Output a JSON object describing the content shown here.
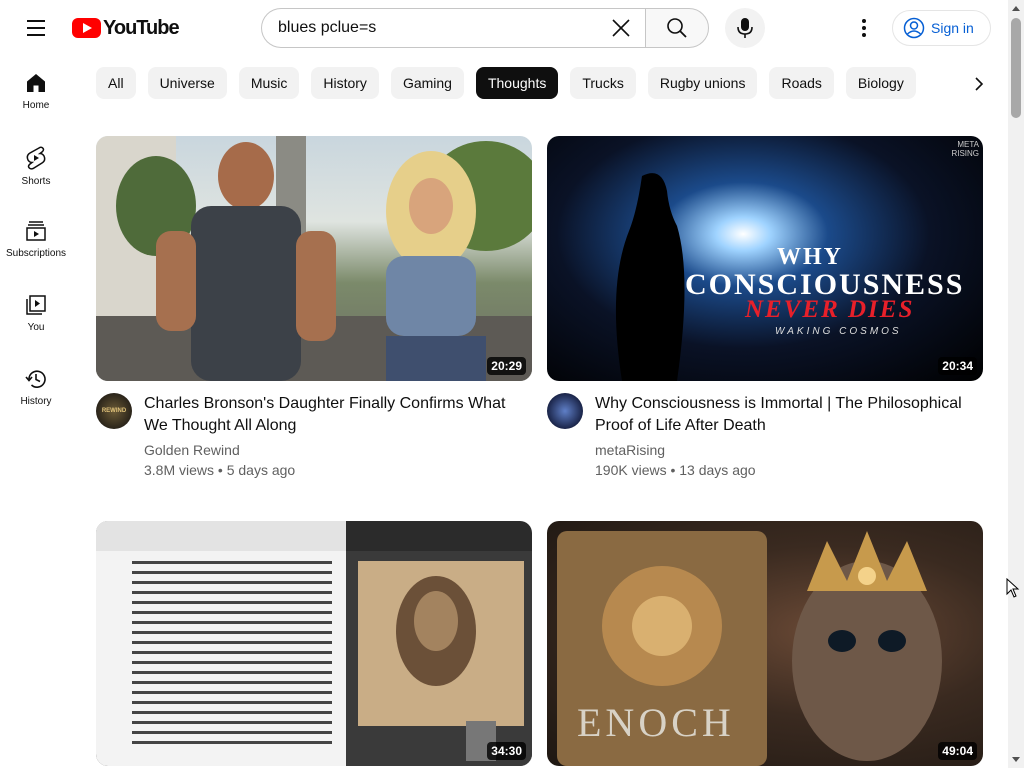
{
  "header": {
    "logo_text": "YouTube",
    "search": {
      "value": "blues pclue=s"
    },
    "signin_label": "Sign in"
  },
  "sidebar": {
    "items": [
      {
        "label": "Home",
        "icon": "home-icon"
      },
      {
        "label": "Shorts",
        "icon": "shorts-icon"
      },
      {
        "label": "Subscriptions",
        "icon": "subscriptions-icon"
      },
      {
        "label": "You",
        "icon": "you-icon"
      },
      {
        "label": "History",
        "icon": "history-icon"
      }
    ]
  },
  "chips": [
    {
      "label": "All",
      "active": false
    },
    {
      "label": "Universe",
      "active": false
    },
    {
      "label": "Music",
      "active": false
    },
    {
      "label": "History",
      "active": false
    },
    {
      "label": "Gaming",
      "active": false
    },
    {
      "label": "Thoughts",
      "active": true
    },
    {
      "label": "Trucks",
      "active": false
    },
    {
      "label": "Rugby unions",
      "active": false
    },
    {
      "label": "Roads",
      "active": false
    },
    {
      "label": "Biology",
      "active": false
    }
  ],
  "videos": [
    {
      "title": "Charles Bronson's Daughter Finally Confirms What We Thought All Along",
      "channel": "Golden Rewind",
      "stats": "3.8M views • 5 days ago",
      "duration": "20:29",
      "avatar_text": "REWIND"
    },
    {
      "title": "Why Consciousness is Immortal | The Philosophical Proof of Life After Death",
      "channel": "metaRising",
      "stats": "190K views • 13 days ago",
      "duration": "20:34",
      "thumb_text": {
        "line1": "WHY",
        "line2": "CONSCIOUSNESS",
        "line3": "NEVER DIES",
        "line4": "WAKING COSMOS",
        "corner": "META RISING"
      }
    },
    {
      "title": "",
      "channel": "",
      "stats": "",
      "duration": "34:30"
    },
    {
      "title": "",
      "channel": "",
      "stats": "",
      "duration": "49:04",
      "thumb_text": {
        "line1": "ENOCH"
      }
    }
  ],
  "colors": {
    "brand_red": "#ff0000",
    "link_blue": "#065fd4",
    "chip_active": "#0f0f0f",
    "chip_bg": "#f2f2f2"
  }
}
